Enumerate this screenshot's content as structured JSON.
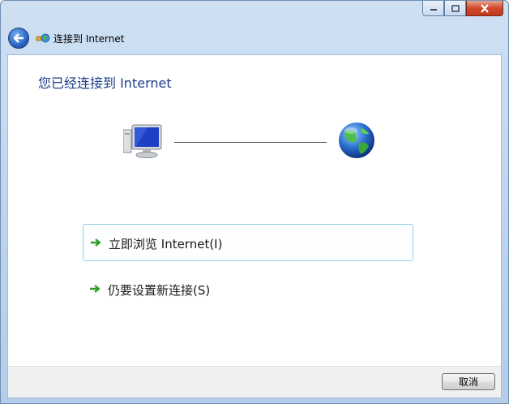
{
  "window": {
    "title": "连接到 Internet",
    "caption_buttons": {
      "minimize_icon": "minimize-icon",
      "maximize_icon": "maximize-icon",
      "close_icon": "close-icon"
    }
  },
  "navbar": {
    "back_icon": "back-arrow-icon",
    "title": "连接到 Internet"
  },
  "main": {
    "heading": "您已经连接到 Internet",
    "diagram": {
      "left_icon": "computer-icon",
      "right_icon": "globe-icon"
    },
    "links": [
      {
        "label": "立即浏览 Internet(I)",
        "icon": "green-arrow-icon",
        "highlighted": true
      },
      {
        "label": "仍要设置新连接(S)",
        "icon": "green-arrow-icon",
        "highlighted": false
      }
    ]
  },
  "footer": {
    "cancel_label": "取消"
  },
  "colors": {
    "heading": "#1b3c8a",
    "link_highlight_border": "#8fd3e6",
    "arrow_green": "#2e9e2e",
    "close_red": "#c73b1f"
  }
}
